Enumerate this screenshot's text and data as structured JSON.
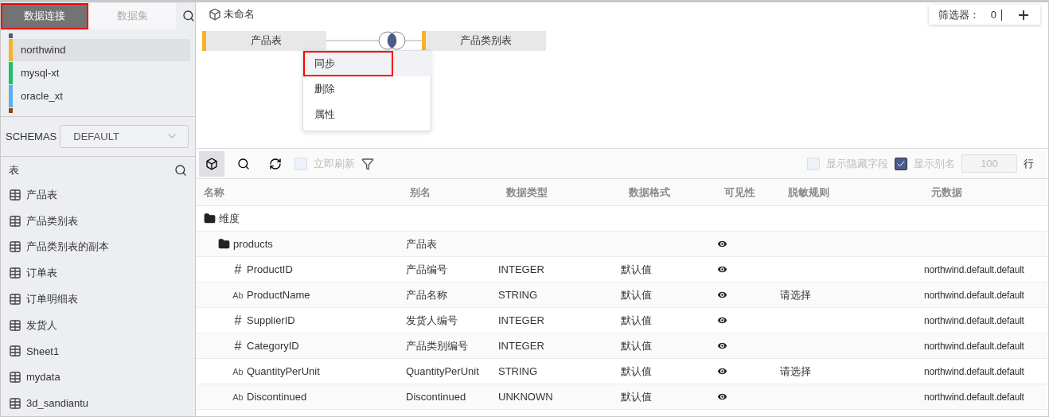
{
  "sidebar": {
    "tabs": [
      {
        "label": "数据连接",
        "selected": true,
        "annotated": true
      },
      {
        "label": "数据集",
        "selected": false,
        "annotated": false
      }
    ],
    "connections": [
      {
        "color": "#4b5b8c"
      },
      {
        "name": "northwind",
        "color": "#f5b325",
        "selected": true
      },
      {
        "name": "mysql-xt",
        "color": "#1fbf6a",
        "selected": false
      },
      {
        "name": "oracle_xt",
        "color": "#5aaef5",
        "selected": false
      },
      {
        "color": "#8b4513"
      }
    ],
    "schemas": {
      "label": "SCHEMAS",
      "value": "DEFAULT"
    },
    "tables_title": "表",
    "tables": [
      "产品表",
      "产品类别表",
      "产品类别表的副本",
      "订单表",
      "订单明细表",
      "发货人",
      "Sheet1",
      "mydata",
      "3d_sandiantu"
    ]
  },
  "canvas": {
    "title": "未命名",
    "filter": {
      "label": "筛选器：",
      "count": "0"
    },
    "join": {
      "left": "产品表",
      "right": "产品类别表"
    },
    "menu": [
      {
        "label": "同步",
        "hovered": true,
        "annotated": true
      },
      {
        "label": "删除",
        "hovered": false,
        "annotated": false
      },
      {
        "label": "属性",
        "hovered": false,
        "annotated": false
      }
    ]
  },
  "toolbar": {
    "refresh_label": "立即刷新",
    "refresh_checked": false,
    "show_hidden_label": "显示隐藏字段",
    "show_hidden_checked": false,
    "show_alias_label": "显示别名",
    "show_alias_checked": true,
    "rows_value": "100",
    "rows_unit": "行"
  },
  "table": {
    "columns": [
      "名称",
      "别名",
      "数据类型",
      "数据格式",
      "可见性",
      "脱敏规则",
      "元数据"
    ],
    "rows": [
      {
        "kind": "folder",
        "name": "维度",
        "children": [
          {
            "kind": "folder",
            "name": "products",
            "alias": "产品表",
            "visible": true,
            "children": [
              {
                "kind": "number",
                "icon": "#",
                "name": "ProductID",
                "alias": "产品编号",
                "type": "INTEGER",
                "format": "默认值",
                "visible": true,
                "meta": "northwind.default.default"
              },
              {
                "kind": "text",
                "icon": "Ab",
                "name": "ProductName",
                "alias": "产品名称",
                "type": "STRING",
                "format": "默认值",
                "visible": true,
                "rule": "请选择",
                "meta": "northwind.default.default"
              },
              {
                "kind": "number",
                "icon": "#",
                "name": "SupplierID",
                "alias": "发货人编号",
                "type": "INTEGER",
                "format": "默认值",
                "visible": true,
                "meta": "northwind.default.default"
              },
              {
                "kind": "number",
                "icon": "#",
                "name": "CategoryID",
                "alias": "产品类别编号",
                "type": "INTEGER",
                "format": "默认值",
                "visible": true,
                "meta": "northwind.default.default"
              },
              {
                "kind": "text",
                "icon": "Ab",
                "name": "QuantityPerUnit",
                "alias": "QuantityPerUnit",
                "type": "STRING",
                "format": "默认值",
                "visible": true,
                "rule": "请选择",
                "meta": "northwind.default.default"
              },
              {
                "kind": "text",
                "icon": "Ab",
                "name": "Discontinued",
                "alias": "Discontinued",
                "type": "UNKNOWN",
                "format": "默认值",
                "visible": true,
                "meta": "northwind.default.default"
              }
            ]
          }
        ]
      }
    ]
  }
}
